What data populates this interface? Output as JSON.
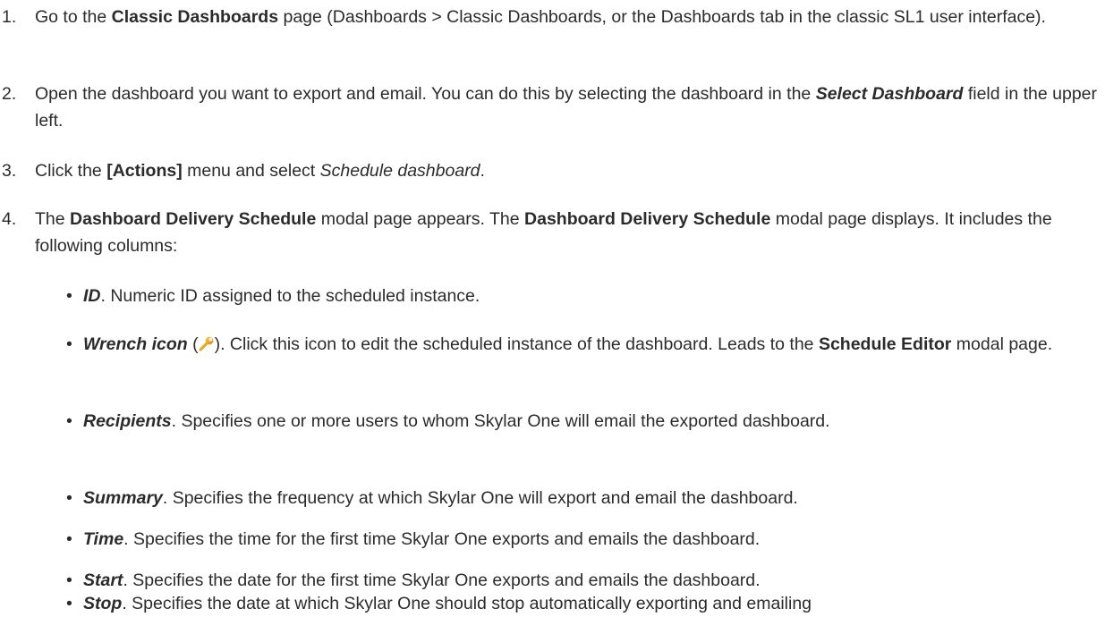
{
  "steps": [
    {
      "num": "1.",
      "t1": "Go to the ",
      "b1": "Classic Dashboards",
      "t2": " page (Dashboards > Classic Dashboards, or the Dashboards tab in the classic SL1 user interface)."
    },
    {
      "num": "2.",
      "t1": "Open the dashboard you want to export and email. You can do this by selecting the dashboard in the ",
      "bi1": "Select Dashboard",
      "t2": " field in the upper left."
    },
    {
      "num": "3.",
      "t1": "Click the ",
      "b1": "[Actions]",
      "t2": " menu and select ",
      "i1": "Schedule dashboard",
      "t3": "."
    },
    {
      "num": "4.",
      "t1": "The ",
      "b1": "Dashboard Delivery Schedule",
      "t2": " modal page appears. The ",
      "b2": "Dashboard Delivery Schedule",
      "t3": " modal page displays. It includes the following columns:"
    }
  ],
  "bullet_char": "•",
  "columns": [
    {
      "term": "ID",
      "desc": ". Numeric ID assigned to the scheduled instance."
    },
    {
      "term": "Wrench icon",
      "pre_icon": " (",
      "icon": "wrench-icon",
      "post_icon": "). Click this icon to edit the scheduled instance of the dashboard. Leads to the ",
      "strong": "Schedule Editor",
      "desc": " modal page."
    },
    {
      "term": "Recipients",
      "desc": ". Specifies one or more users to whom Skylar One will email the exported dashboard."
    },
    {
      "term": "Summary",
      "desc": ". Specifies the frequency at which Skylar One will export and email the dashboard."
    },
    {
      "term": "Time",
      "desc": ". Specifies the time for the first time Skylar One exports and emails the dashboard."
    },
    {
      "term": "Start",
      "desc": ". Specifies the date for the first time Skylar One exports and emails the dashboard."
    },
    {
      "term": "Stop",
      "desc": ". Specifies the date at which Skylar One should stop automatically exporting and emailing"
    }
  ]
}
